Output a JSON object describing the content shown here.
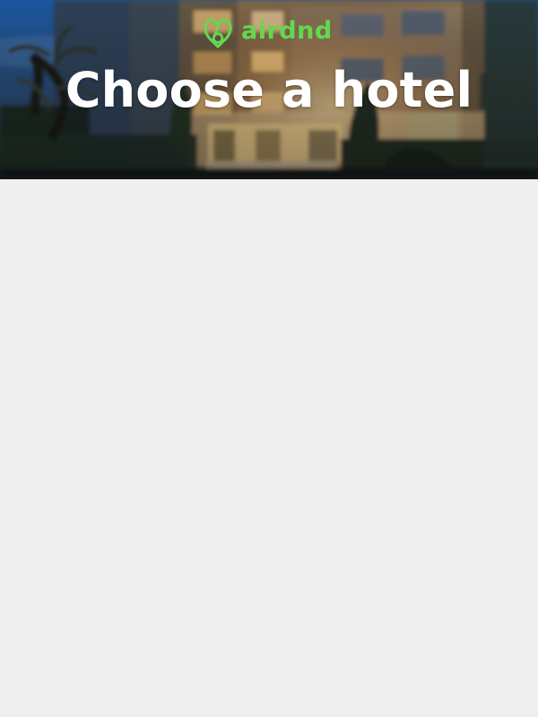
{
  "brand": {
    "name": "airdnd",
    "icon": "airbnb-heart-logo-icon",
    "color": "#63d84f"
  },
  "hero": {
    "title": "Choose a hotel",
    "background_image": "blurred-hotel-facade-at-dusk"
  },
  "colors": {
    "page_background": "#efefef",
    "title_text": "#ffffff"
  }
}
